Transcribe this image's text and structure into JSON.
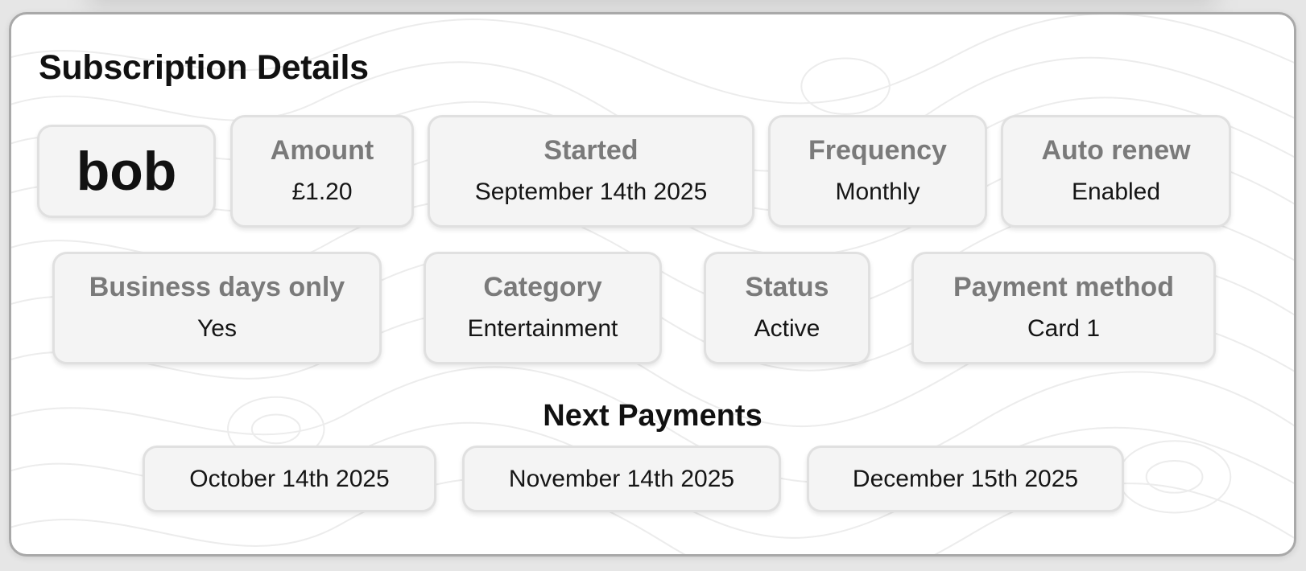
{
  "panel": {
    "title": "Subscription Details",
    "subscription_name": "bob"
  },
  "details_row1": [
    {
      "label": "Amount",
      "value": "£1.20"
    },
    {
      "label": "Started",
      "value": "September 14th 2025"
    },
    {
      "label": "Frequency",
      "value": "Monthly"
    },
    {
      "label": "Auto renew",
      "value": "Enabled"
    }
  ],
  "details_row2": [
    {
      "label": "Business days only",
      "value": "Yes"
    },
    {
      "label": "Category",
      "value": "Entertainment"
    },
    {
      "label": "Status",
      "value": "Active"
    },
    {
      "label": "Payment method",
      "value": "Card 1"
    }
  ],
  "next_payments": {
    "title": "Next Payments",
    "dates": [
      "October 14th 2025",
      "November 14th 2025",
      "December 15th 2025"
    ]
  },
  "colors": {
    "card_background": "#f4f4f4",
    "label_text": "#7a7a7a",
    "value_text": "#151515",
    "panel_border": "#a9a9a9"
  }
}
